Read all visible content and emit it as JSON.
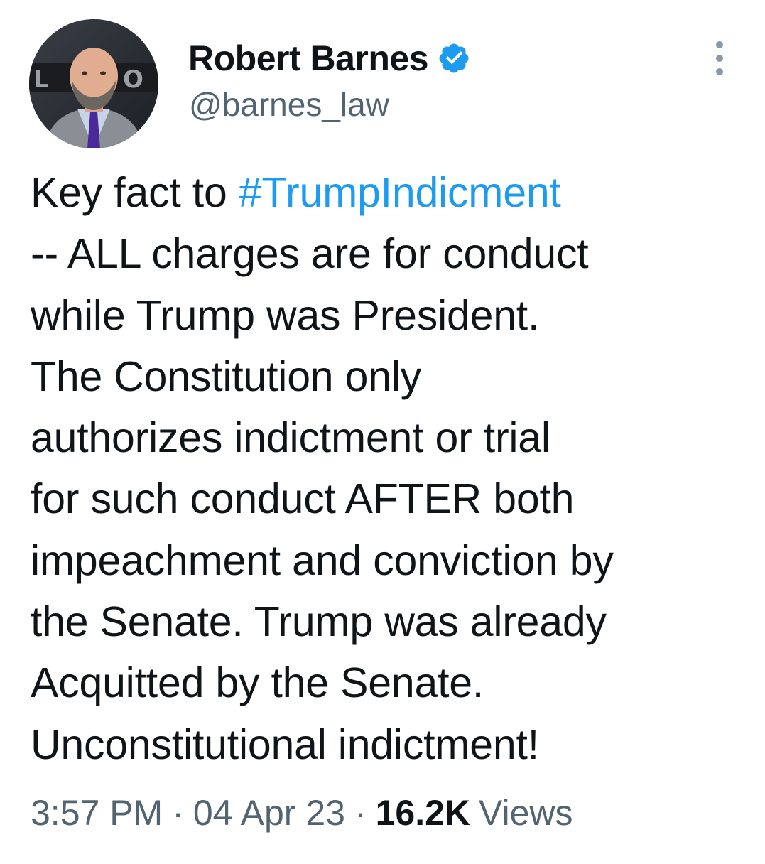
{
  "author": {
    "display_name": "Robert Barnes",
    "handle": "@barnes_law",
    "verified": true,
    "avatar_icon": "profile-photo"
  },
  "more_icon": "ellipsis-vertical-icon",
  "tweet": {
    "lines": [
      {
        "pre": "Key fact to ",
        "hashtag": "#TrumpIndicment"
      },
      {
        "text": "-- ALL charges are for conduct"
      },
      {
        "text": "while Trump was President."
      },
      {
        "text": "The Constitution only"
      },
      {
        "text": "authorizes indictment or trial"
      },
      {
        "text": "for such conduct AFTER both"
      },
      {
        "text": "impeachment and conviction by"
      },
      {
        "text": "the Senate. Trump was already"
      },
      {
        "text": "Acquitted by the Senate."
      },
      {
        "text": "Unconstitutional indictment!"
      }
    ]
  },
  "meta": {
    "time": "3:57 PM",
    "separator": "·",
    "date": "04 Apr 23",
    "views_count": "16.2K",
    "views_label": "Views"
  },
  "colors": {
    "hashtag": "#1d9bf0",
    "secondary_text": "#536471",
    "primary_text": "#0f1419",
    "verified_badge": "#1d9bf0"
  }
}
